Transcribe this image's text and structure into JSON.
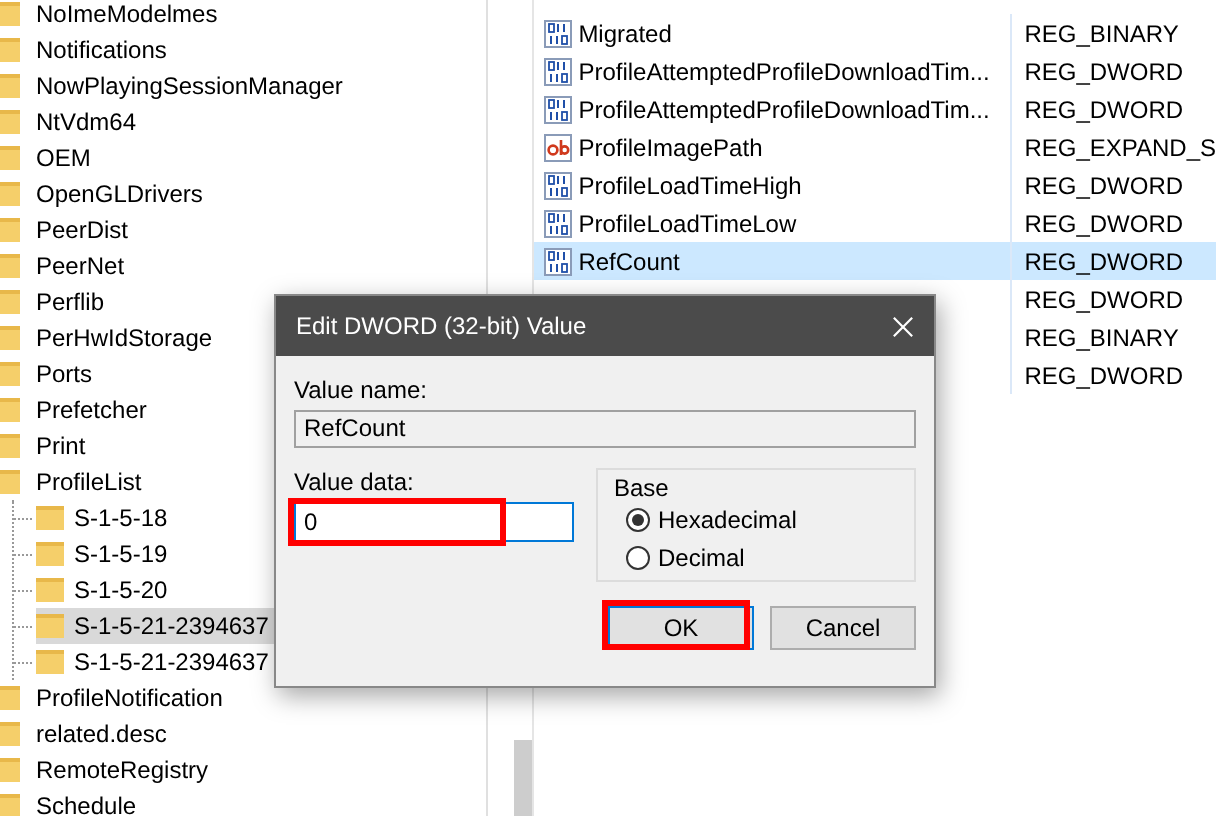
{
  "tree": {
    "items": [
      {
        "label": "NoImeModelmes",
        "selected": false
      },
      {
        "label": "Notifications",
        "selected": false
      },
      {
        "label": "NowPlayingSessionManager",
        "selected": false
      },
      {
        "label": "NtVdm64",
        "selected": false
      },
      {
        "label": "OEM",
        "selected": false
      },
      {
        "label": "OpenGLDrivers",
        "selected": false
      },
      {
        "label": "PeerDist",
        "selected": false
      },
      {
        "label": "PeerNet",
        "selected": false
      },
      {
        "label": "Perflib",
        "selected": false
      },
      {
        "label": "PerHwIdStorage",
        "selected": false
      },
      {
        "label": "Ports",
        "selected": false
      },
      {
        "label": "Prefetcher",
        "selected": false
      },
      {
        "label": "Print",
        "selected": false
      },
      {
        "label": "ProfileList",
        "selected": false,
        "children": [
          {
            "label": "S-1-5-18",
            "selected": false
          },
          {
            "label": "S-1-5-19",
            "selected": false
          },
          {
            "label": "S-1-5-20",
            "selected": false
          },
          {
            "label": "S-1-5-21-2394637",
            "selected": true
          },
          {
            "label": "S-1-5-21-2394637",
            "selected": false
          }
        ]
      },
      {
        "label": "ProfileNotification",
        "selected": false
      },
      {
        "label": "related.desc",
        "selected": false
      },
      {
        "label": "RemoteRegistry",
        "selected": false
      },
      {
        "label": "Schedule",
        "selected": false
      }
    ]
  },
  "values": {
    "rows": [
      {
        "kind": "binary",
        "name": "Migrated",
        "type": "REG_BINARY",
        "selected": false
      },
      {
        "kind": "binary",
        "name": "ProfileAttemptedProfileDownloadTim...",
        "type": "REG_DWORD",
        "selected": false
      },
      {
        "kind": "binary",
        "name": "ProfileAttemptedProfileDownloadTim...",
        "type": "REG_DWORD",
        "selected": false
      },
      {
        "kind": "string",
        "name": "ProfileImagePath",
        "type": "REG_EXPAND_S",
        "selected": false
      },
      {
        "kind": "binary",
        "name": "ProfileLoadTimeHigh",
        "type": "REG_DWORD",
        "selected": false
      },
      {
        "kind": "binary",
        "name": "ProfileLoadTimeLow",
        "type": "REG_DWORD",
        "selected": false
      },
      {
        "kind": "binary",
        "name": "RefCount",
        "type": "REG_DWORD",
        "selected": true
      },
      {
        "type": "REG_DWORD",
        "selected": false
      },
      {
        "type": "REG_BINARY",
        "selected": false
      },
      {
        "type": "REG_DWORD",
        "selected": false
      }
    ]
  },
  "dialog": {
    "title": "Edit DWORD (32-bit) Value",
    "value_name": {
      "label": "Value name:",
      "value": "RefCount"
    },
    "value_data": {
      "label": "Value data:",
      "value": "0",
      "highlighted": true
    },
    "base": {
      "label": "Base",
      "options": [
        {
          "label": "Hexadecimal",
          "selected": true
        },
        {
          "label": "Decimal",
          "selected": false
        }
      ]
    },
    "buttons": [
      {
        "label": "OK",
        "highlighted": true
      },
      {
        "label": "Cancel",
        "highlighted": false
      }
    ]
  }
}
